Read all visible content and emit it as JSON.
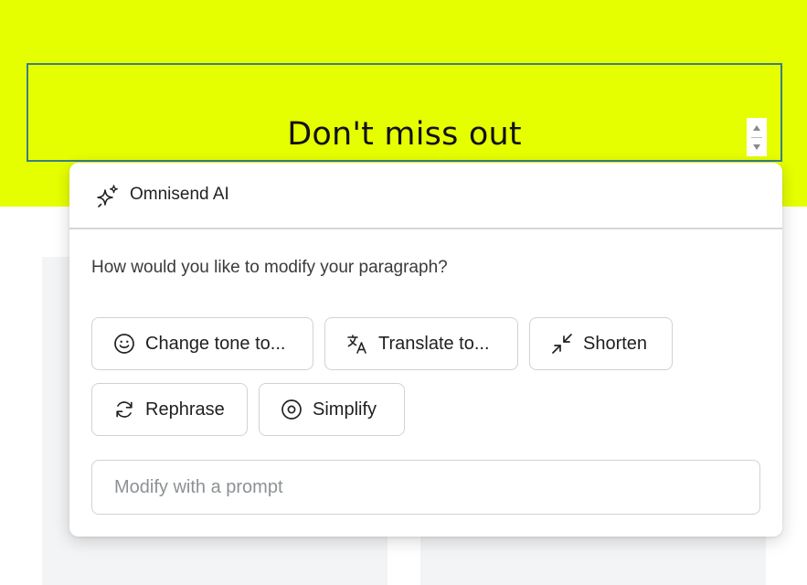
{
  "hero": {
    "headline": "Don't miss out",
    "background_color": "#e6ff00",
    "selection_border_color": "#3a7f86",
    "stepper": {
      "up_icon": "triangle-up-icon",
      "down_icon": "triangle-down-icon"
    }
  },
  "ai_panel": {
    "title": "Omnisend AI",
    "title_icon": "sparkle-icon",
    "question": "How would you like to modify your paragraph?",
    "actions": [
      {
        "label": "Change tone to...",
        "icon": "smiley-icon"
      },
      {
        "label": "Translate to...",
        "icon": "translate-icon"
      },
      {
        "label": "Shorten",
        "icon": "collapse-arrows-icon"
      },
      {
        "label": "Rephrase",
        "icon": "refresh-icon"
      },
      {
        "label": "Simplify",
        "icon": "target-circle-icon"
      }
    ],
    "prompt": {
      "placeholder": "Modify with a prompt",
      "value": ""
    }
  }
}
